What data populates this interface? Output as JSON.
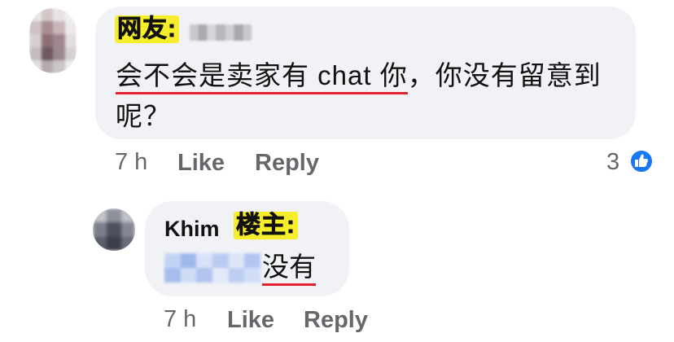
{
  "comments": [
    {
      "tag": "网友:",
      "text_underlined": "会不会是卖家有 chat 你",
      "text_rest": "，你没有留意到呢？",
      "time": "7 h",
      "like_label": "Like",
      "reply_label": "Reply",
      "reaction_count": "3",
      "reaction_icon": "thumbs-up-icon"
    },
    {
      "author": "Khim",
      "tag": "楼主:",
      "text_underlined": "没有",
      "time": "7 h",
      "like_label": "Like",
      "reply_label": "Reply"
    }
  ],
  "colors": {
    "bubble": "#f0f2f5",
    "tag_highlight": "#f6ee2a",
    "underline": "#e0212a",
    "meta_text": "#65676b",
    "like_blue": "#1877f2"
  }
}
